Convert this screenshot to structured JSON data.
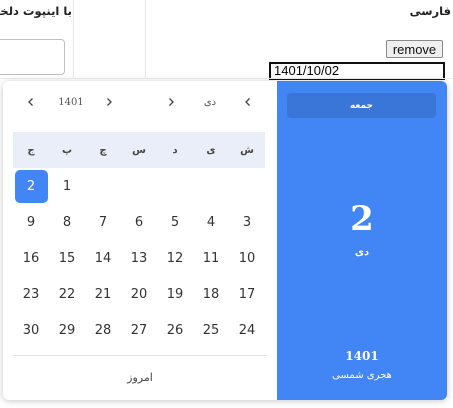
{
  "page": {
    "left_column_heading": "با اینپوت دلخواه",
    "right_column_heading": "فارسی",
    "remove_button_label": "remove",
    "date_input_value": "1401/10/02"
  },
  "calendar": {
    "year_label": "1401",
    "month_label": "دی",
    "weekday_headers": [
      "ش",
      "ی",
      "د",
      "س",
      "چ",
      "پ",
      "ج"
    ],
    "weeks": [
      [
        "",
        "",
        "",
        "",
        "",
        "1",
        "2"
      ],
      [
        "3",
        "4",
        "5",
        "6",
        "7",
        "8",
        "9"
      ],
      [
        "10",
        "11",
        "12",
        "13",
        "14",
        "15",
        "16"
      ],
      [
        "17",
        "18",
        "19",
        "20",
        "21",
        "22",
        "23"
      ],
      [
        "24",
        "25",
        "26",
        "27",
        "28",
        "29",
        "30"
      ]
    ],
    "selected_day": "2",
    "today_button_label": "امروز",
    "accent_color": "#4285f4",
    "icons": {
      "prev_year": "chevron-left-icon",
      "next_year": "chevron-right-icon",
      "prev_month": "chevron-left-icon",
      "next_month": "chevron-right-icon"
    }
  },
  "side_panel": {
    "weekday_name": "جمعه",
    "day_number": "2",
    "month_name": "دی",
    "year": "1401",
    "calendar_name": "هجری شمسی"
  }
}
